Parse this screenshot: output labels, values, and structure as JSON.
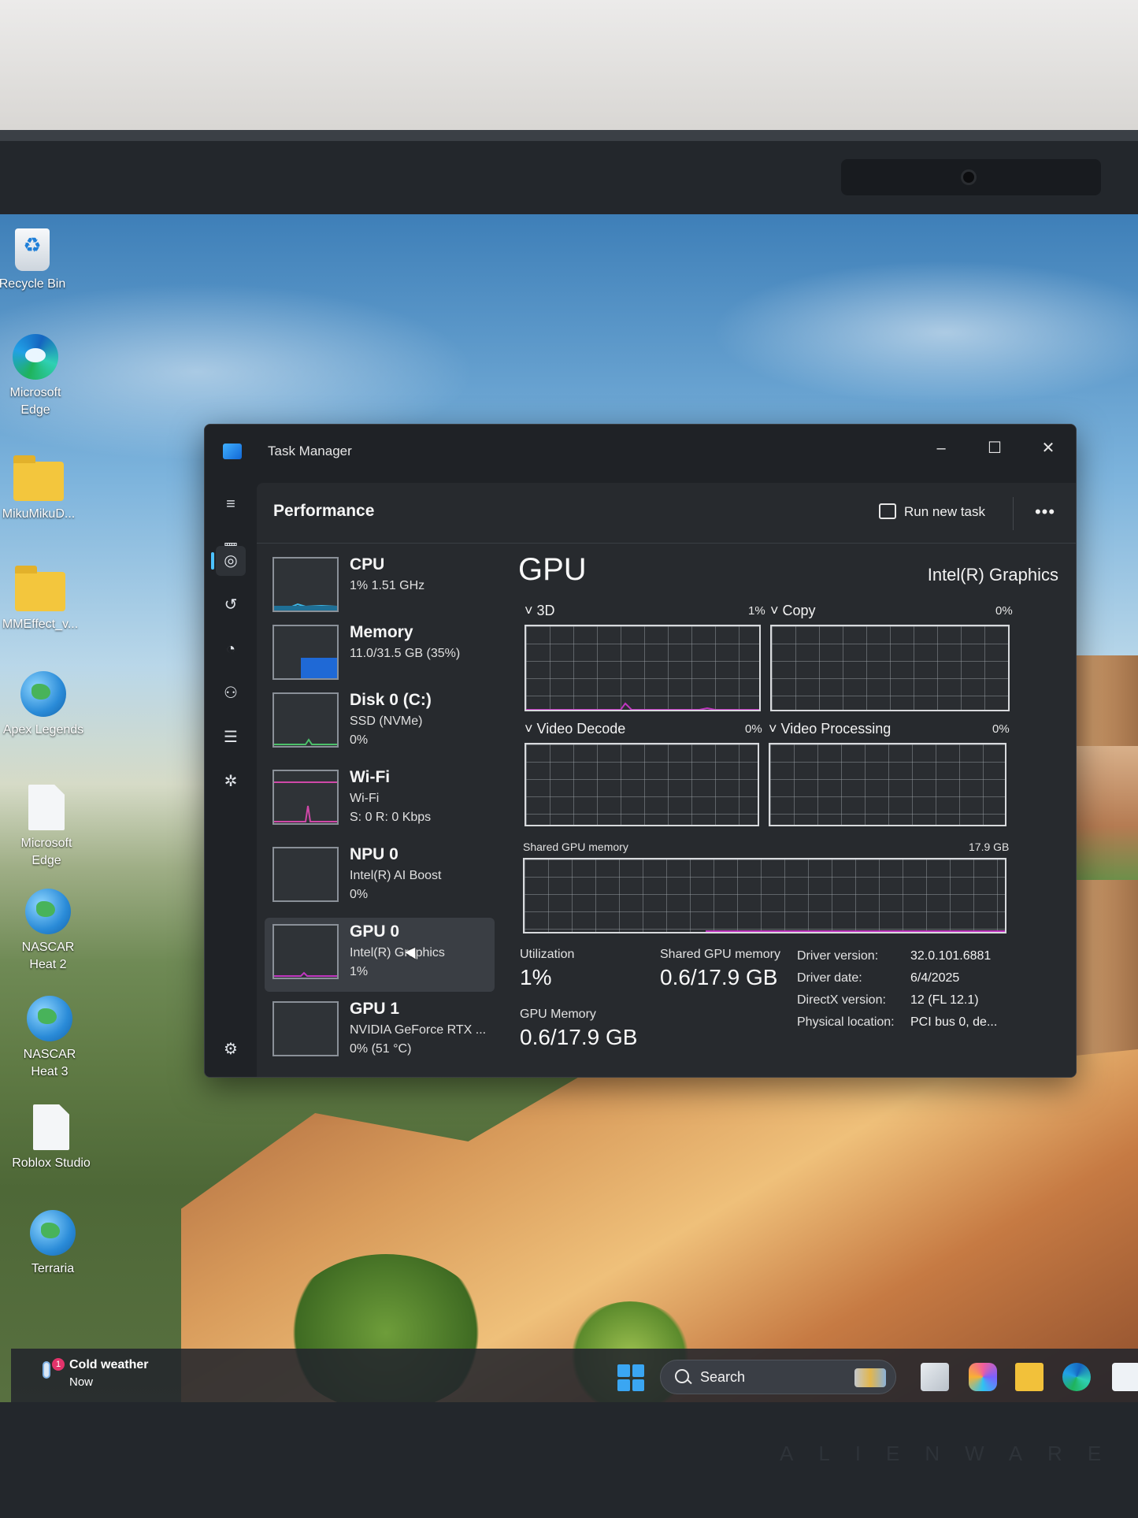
{
  "desktop": {
    "icons": [
      {
        "label": "Recycle Bin",
        "icon": "recycle-bin-icon"
      },
      {
        "label": "Microsoft Edge",
        "icon": "edge-icon"
      },
      {
        "label": "MikuMikuD...",
        "icon": "folder-icon"
      },
      {
        "label": "MMEffect_v...",
        "icon": "folder-icon"
      },
      {
        "label": "Apex Legends",
        "icon": "globe-icon"
      },
      {
        "label": "Microsoft Edge",
        "icon": "document-icon"
      },
      {
        "label": "NASCAR Heat 2",
        "icon": "globe-icon"
      },
      {
        "label": "NASCAR Heat 3",
        "icon": "globe-icon"
      },
      {
        "label": "Roblox Studio",
        "icon": "document-icon"
      },
      {
        "label": "Terraria",
        "icon": "globe-icon"
      }
    ]
  },
  "window": {
    "title": "Task Manager",
    "controls": {
      "minimize": "–",
      "maximize": "☐",
      "close": "✕"
    }
  },
  "nav": {
    "items": [
      "hamburger-icon",
      "processes-icon",
      "performance-icon",
      "app-history-icon",
      "startup-apps-icon",
      "users-icon",
      "details-icon",
      "services-icon"
    ],
    "settings": "settings-icon",
    "active": "performance-icon"
  },
  "header": {
    "title": "Performance",
    "run_new_task": "Run new task",
    "more": "•••"
  },
  "devices": [
    {
      "name": "CPU",
      "line2": "1% 1.51 GHz",
      "line3": ""
    },
    {
      "name": "Memory",
      "line2": "11.0/31.5 GB (35%)",
      "line3": ""
    },
    {
      "name": "Disk 0 (C:)",
      "line2": "SSD (NVMe)",
      "line3": "0%"
    },
    {
      "name": "Wi-Fi",
      "line2": "Wi-Fi",
      "line3": "S: 0 R: 0 Kbps"
    },
    {
      "name": "NPU 0",
      "line2": "Intel(R) AI Boost",
      "line3": "0%"
    },
    {
      "name": "GPU 0",
      "line2": "Intel(R) Graphics",
      "line3": "1%"
    },
    {
      "name": "GPU 1",
      "line2": "NVIDIA GeForce RTX ...",
      "line3": "0% (51 °C)"
    }
  ],
  "selected_device": "GPU 0",
  "detail": {
    "title": "GPU",
    "model": "Intel(R) Graphics",
    "engines": [
      {
        "label": "3D",
        "value": "1%"
      },
      {
        "label": "Copy",
        "value": "0%"
      },
      {
        "label": "Video Decode",
        "value": "0%"
      },
      {
        "label": "Video Processing",
        "value": "0%"
      }
    ],
    "shared_memory_label": "Shared GPU memory",
    "shared_memory_max": "17.9 GB",
    "stats": {
      "utilization_label": "Utilization",
      "utilization_value": "1%",
      "shared_label": "Shared GPU memory",
      "shared_value": "0.6/17.9 GB",
      "gpu_memory_label": "GPU Memory",
      "gpu_memory_value": "0.6/17.9 GB"
    },
    "info": [
      {
        "key": "Driver version:",
        "value": "32.0.101.6881"
      },
      {
        "key": "Driver date:",
        "value": "6/4/2025"
      },
      {
        "key": "DirectX version:",
        "value": "12 (FL 12.1)"
      },
      {
        "key": "Physical location:",
        "value": "PCI bus 0, de..."
      }
    ]
  },
  "taskbar": {
    "weather_title": "Cold weather",
    "weather_sub": "Now",
    "weather_badge": "1",
    "search_label": "Search",
    "apps": [
      "file-explorer-window-icon",
      "copilot-icon",
      "folder-icon",
      "edge-icon",
      "store-icon"
    ]
  },
  "colors": {
    "accent": "#4cc2ff",
    "gpu_graph": "#c036c0",
    "selected_item": "#3a3e44"
  },
  "brand": "ALIENWARE"
}
